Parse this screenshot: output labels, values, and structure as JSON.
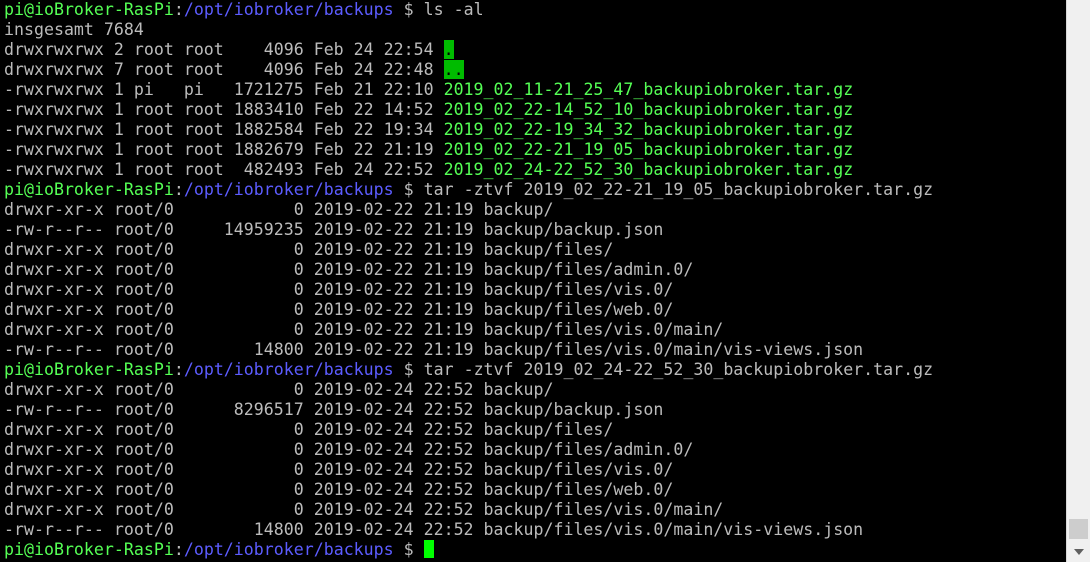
{
  "terminal": {
    "lines": [
      [
        {
          "t": "pi@ioBroker-RasPi",
          "c": "host"
        },
        {
          "t": ":",
          "c": "text"
        },
        {
          "t": "/opt/iobroker/backups",
          "c": "path"
        },
        {
          "t": " $ ls -al",
          "c": "text"
        }
      ],
      [
        {
          "t": "insgesamt 7684",
          "c": "text"
        }
      ],
      [
        {
          "t": "drwxrwxrwx 2 root root    4096 Feb 24 22:54 ",
          "c": "text"
        },
        {
          "t": ".",
          "c": "dir"
        }
      ],
      [
        {
          "t": "drwxrwxrwx 7 root root    4096 Feb 24 22:48 ",
          "c": "text"
        },
        {
          "t": "..",
          "c": "dir"
        }
      ],
      [
        {
          "t": "-rwxrwxrwx 1 pi   pi   1721275 Feb 21 22:10 ",
          "c": "text"
        },
        {
          "t": "2019_02_11-21_25_47_backupiobroker.tar.gz",
          "c": "file"
        }
      ],
      [
        {
          "t": "-rwxrwxrwx 1 root root 1883410 Feb 22 14:52 ",
          "c": "text"
        },
        {
          "t": "2019_02_22-14_52_10_backupiobroker.tar.gz",
          "c": "file"
        }
      ],
      [
        {
          "t": "-rwxrwxrwx 1 root root 1882584 Feb 22 19:34 ",
          "c": "text"
        },
        {
          "t": "2019_02_22-19_34_32_backupiobroker.tar.gz",
          "c": "file"
        }
      ],
      [
        {
          "t": "-rwxrwxrwx 1 root root 1882679 Feb 22 21:19 ",
          "c": "text"
        },
        {
          "t": "2019_02_22-21_19_05_backupiobroker.tar.gz",
          "c": "file"
        }
      ],
      [
        {
          "t": "-rwxrwxrwx 1 root root  482493 Feb 24 22:52 ",
          "c": "text"
        },
        {
          "t": "2019_02_24-22_52_30_backupiobroker.tar.gz",
          "c": "file"
        }
      ],
      [
        {
          "t": "pi@ioBroker-RasPi",
          "c": "host"
        },
        {
          "t": ":",
          "c": "text"
        },
        {
          "t": "/opt/iobroker/backups",
          "c": "path"
        },
        {
          "t": " $ tar -ztvf 2019_02_22-21_19_05_backupiobroker.tar.gz",
          "c": "text"
        }
      ],
      [
        {
          "t": "drwxr-xr-x root/0            0 2019-02-22 21:19 backup/",
          "c": "text"
        }
      ],
      [
        {
          "t": "-rw-r--r-- root/0     14959235 2019-02-22 21:19 backup/backup.json",
          "c": "text"
        }
      ],
      [
        {
          "t": "drwxr-xr-x root/0            0 2019-02-22 21:19 backup/files/",
          "c": "text"
        }
      ],
      [
        {
          "t": "drwxr-xr-x root/0            0 2019-02-22 21:19 backup/files/admin.0/",
          "c": "text"
        }
      ],
      [
        {
          "t": "drwxr-xr-x root/0            0 2019-02-22 21:19 backup/files/vis.0/",
          "c": "text"
        }
      ],
      [
        {
          "t": "drwxr-xr-x root/0            0 2019-02-22 21:19 backup/files/web.0/",
          "c": "text"
        }
      ],
      [
        {
          "t": "drwxr-xr-x root/0            0 2019-02-22 21:19 backup/files/vis.0/main/",
          "c": "text"
        }
      ],
      [
        {
          "t": "-rw-r--r-- root/0        14800 2019-02-22 21:19 backup/files/vis.0/main/vis-views.json",
          "c": "text"
        }
      ],
      [
        {
          "t": "pi@ioBroker-RasPi",
          "c": "host"
        },
        {
          "t": ":",
          "c": "text"
        },
        {
          "t": "/opt/iobroker/backups",
          "c": "path"
        },
        {
          "t": " $ tar -ztvf 2019_02_24-22_52_30_backupiobroker.tar.gz",
          "c": "text"
        }
      ],
      [
        {
          "t": "drwxr-xr-x root/0            0 2019-02-24 22:52 backup/",
          "c": "text"
        }
      ],
      [
        {
          "t": "-rw-r--r-- root/0      8296517 2019-02-24 22:52 backup/backup.json",
          "c": "text"
        }
      ],
      [
        {
          "t": "drwxr-xr-x root/0            0 2019-02-24 22:52 backup/files/",
          "c": "text"
        }
      ],
      [
        {
          "t": "drwxr-xr-x root/0            0 2019-02-24 22:52 backup/files/admin.0/",
          "c": "text"
        }
      ],
      [
        {
          "t": "drwxr-xr-x root/0            0 2019-02-24 22:52 backup/files/vis.0/",
          "c": "text"
        }
      ],
      [
        {
          "t": "drwxr-xr-x root/0            0 2019-02-24 22:52 backup/files/web.0/",
          "c": "text"
        }
      ],
      [
        {
          "t": "drwxr-xr-x root/0            0 2019-02-24 22:52 backup/files/vis.0/main/",
          "c": "text"
        }
      ],
      [
        {
          "t": "-rw-r--r-- root/0        14800 2019-02-24 22:52 backup/files/vis.0/main/vis-views.json",
          "c": "text"
        }
      ],
      [
        {
          "t": "pi@ioBroker-RasPi",
          "c": "host"
        },
        {
          "t": ":",
          "c": "text"
        },
        {
          "t": "/opt/iobroker/backups",
          "c": "path"
        },
        {
          "t": " $ ",
          "c": "text"
        },
        {
          "t": "",
          "c": "cursor"
        }
      ]
    ]
  },
  "colors": {
    "background": "#000000",
    "text": "#bbbbbb",
    "host": "#55ff55",
    "path": "#5c5cff",
    "file": "#55ff55",
    "dir_bg": "#00bb00",
    "cursor": "#00ff00"
  },
  "scrollbar": {
    "down_icon": "chevron-down-icon"
  }
}
